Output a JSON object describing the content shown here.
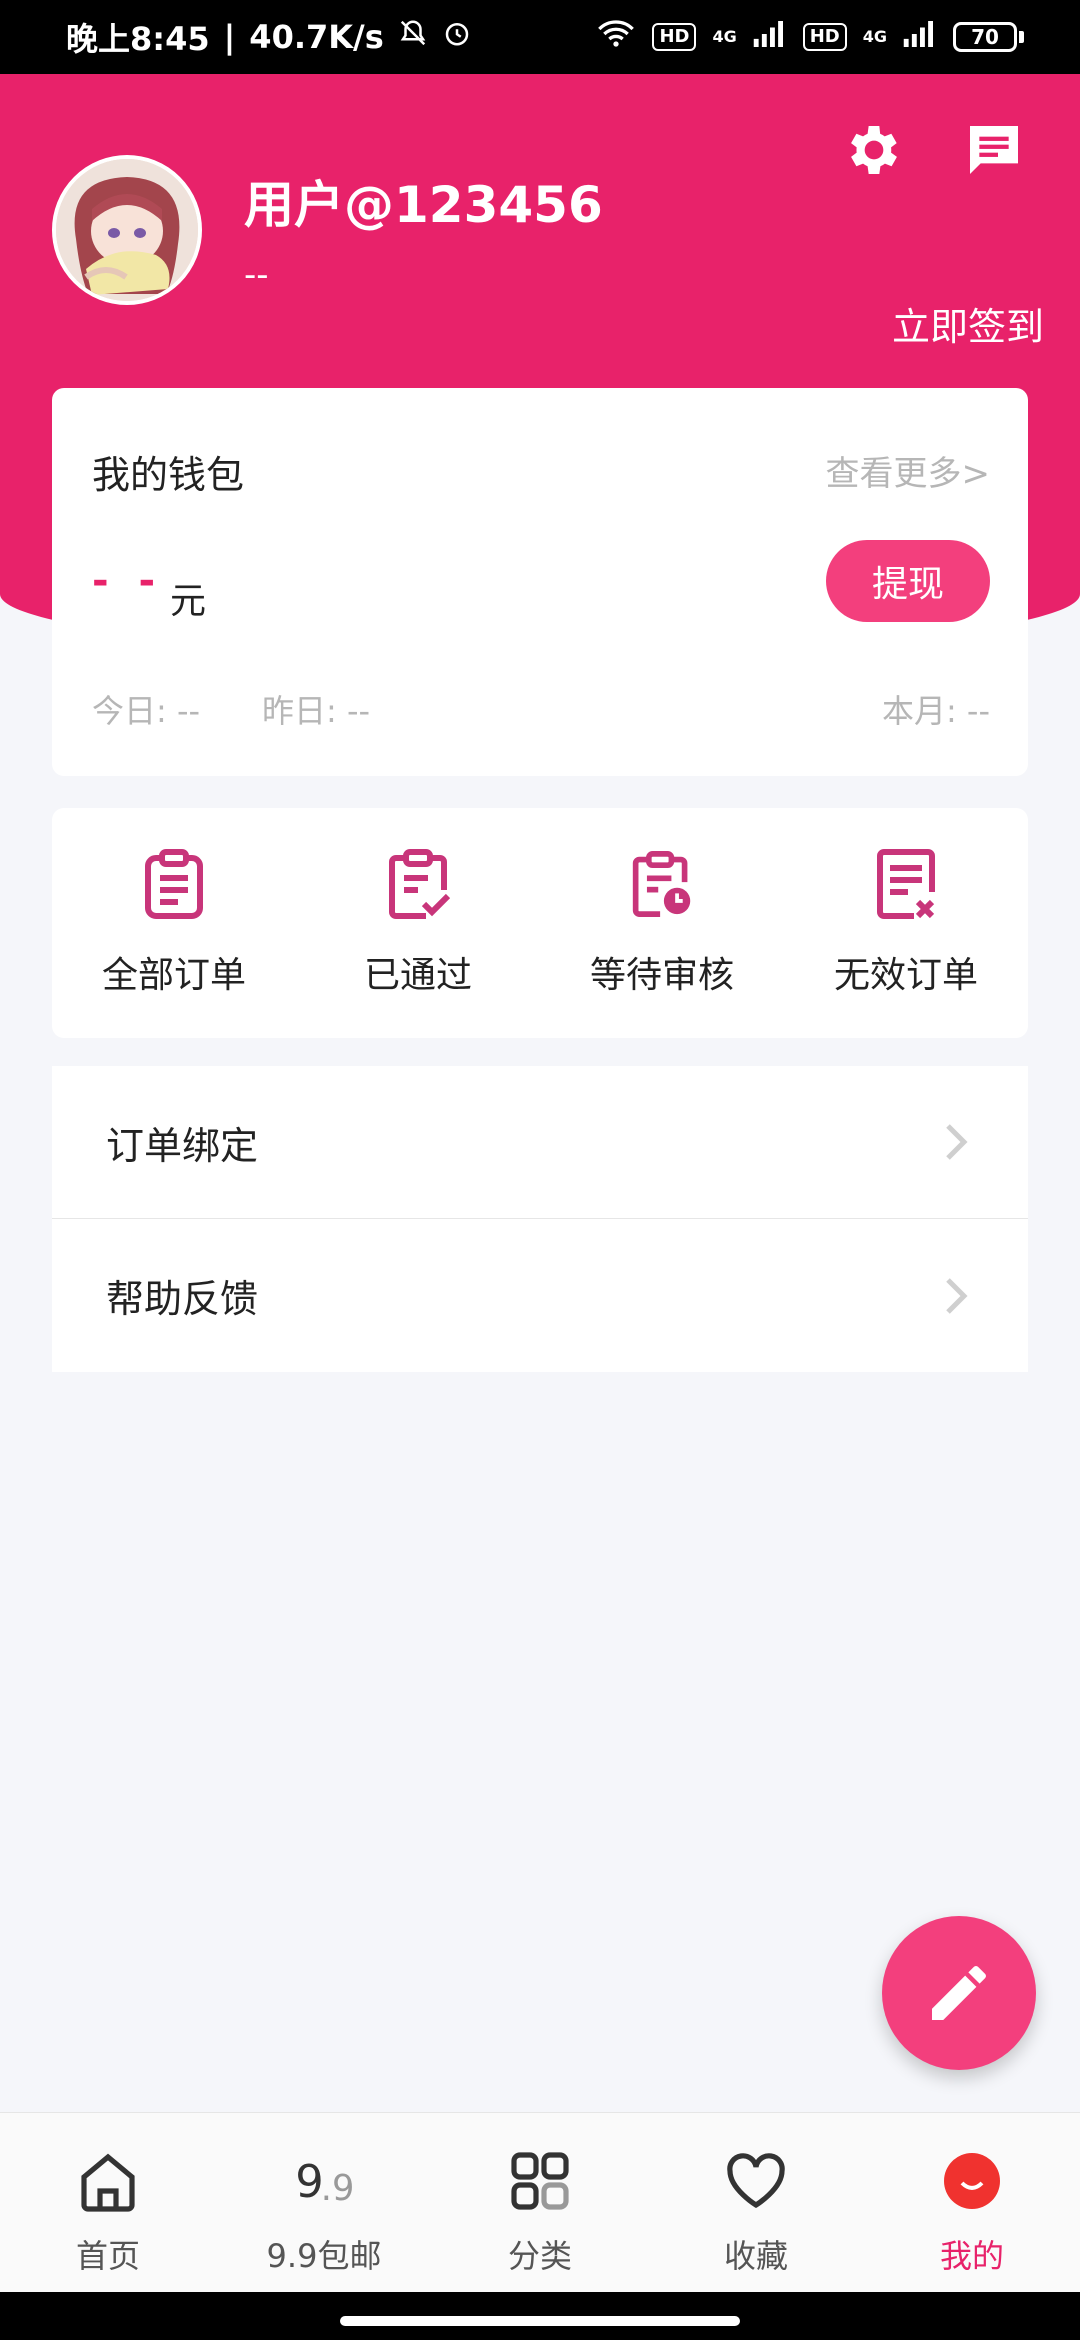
{
  "status_bar": {
    "time": "晚上8:45",
    "speed": "40.7K/s",
    "hd1": "HD",
    "hd2": "HD",
    "net1": "4G",
    "net2": "4G",
    "battery": "70"
  },
  "header": {
    "username": "用户@123456",
    "subtitle": "--",
    "sign_in": "立即签到",
    "colors": {
      "primary": "#e8226a",
      "accent": "#f33f7d"
    }
  },
  "wallet": {
    "title": "我的钱包",
    "more": "查看更多>",
    "balance": "- -",
    "unit": "元",
    "withdraw": "提现",
    "today": "今日: --",
    "yesterday": "昨日: --",
    "month": "本月: --"
  },
  "orders": [
    {
      "label": "全部订单",
      "icon": "clipboard-list-icon"
    },
    {
      "label": "已通过",
      "icon": "clipboard-check-icon"
    },
    {
      "label": "等待审核",
      "icon": "clipboard-clock-icon"
    },
    {
      "label": "无效订单",
      "icon": "document-x-icon"
    }
  ],
  "menu": [
    {
      "label": "订单绑定"
    },
    {
      "label": "帮助反馈"
    }
  ],
  "nav": [
    {
      "label": "首页",
      "icon": "home-icon"
    },
    {
      "label": "9.9包邮",
      "icon": "nine-nine-icon"
    },
    {
      "label": "分类",
      "icon": "grid-icon"
    },
    {
      "label": "收藏",
      "icon": "heart-icon"
    },
    {
      "label": "我的",
      "icon": "profile-icon",
      "active": true
    }
  ]
}
